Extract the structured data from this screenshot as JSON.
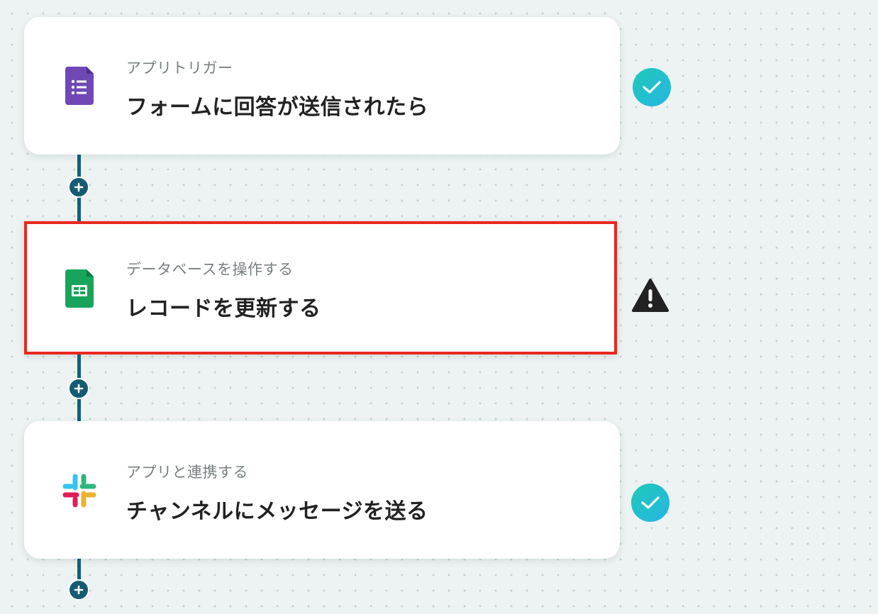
{
  "steps": [
    {
      "kind": "アプリトリガー",
      "title": "フォームに回答が送信されたら",
      "app_icon": "google-forms-icon",
      "status": "success"
    },
    {
      "kind": "データベースを操作する",
      "title": "レコードを更新する",
      "app_icon": "google-sheets-icon",
      "status": "warning",
      "selected": true
    },
    {
      "kind": "アプリと連携する",
      "title": "チャンネルにメッセージを送る",
      "app_icon": "slack-icon",
      "status": "success"
    }
  ],
  "colors": {
    "flow_line": "#155f78",
    "add_button": "#135c73",
    "selection_border": "#e8291f",
    "success_gradient_start": "#1ec9b8",
    "success_gradient_end": "#27b6e3",
    "warning": "#222222",
    "forms_purple": "#7048b6",
    "sheets_green": "#18a45b"
  },
  "icons": {
    "add": "plus-icon",
    "success": "check-circle-icon",
    "warning": "warning-triangle-icon"
  }
}
